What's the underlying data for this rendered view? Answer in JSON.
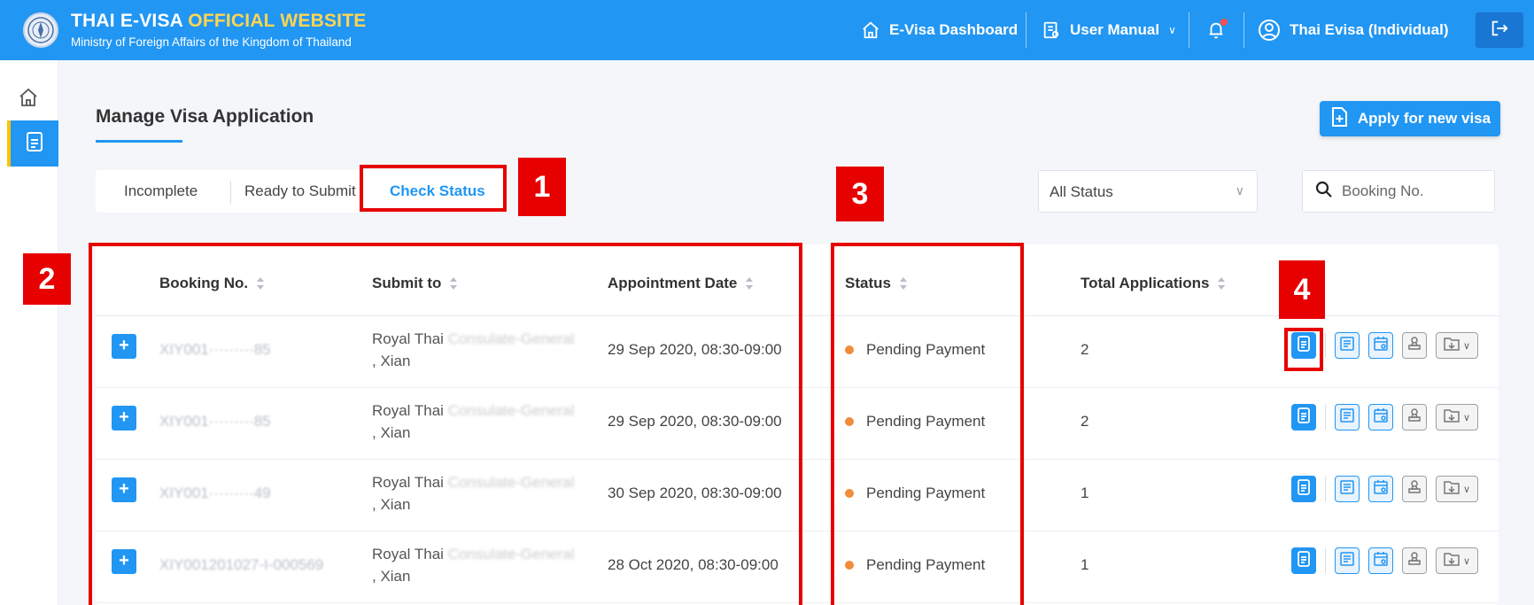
{
  "header": {
    "title_main": "THAI E-VISA ",
    "title_highlight": "OFFICIAL WEBSITE",
    "subtitle": "Ministry of Foreign Affairs of the Kingdom of Thailand",
    "nav": {
      "dashboard": "E-Visa Dashboard",
      "manual": "User Manual",
      "user": "Thai Evisa (Individual)"
    }
  },
  "page": {
    "title": "Manage Visa Application",
    "apply_button": "Apply for new visa"
  },
  "tabs": [
    "Incomplete",
    "Ready to Submit",
    "Check Status"
  ],
  "filters": {
    "status_selected": "All Status",
    "search_placeholder": "Booking No."
  },
  "table": {
    "columns": [
      "Booking No.",
      "Submit to",
      "Appointment Date",
      "Status",
      "Total Applications"
    ],
    "rows": [
      {
        "booking": "XIY001·········85",
        "submit_line1": "Royal Thai ",
        "submit_faded": "Consulate-General",
        "submit_line2": ", Xian",
        "appointment": "29 Sep 2020, 08:30-09:00",
        "status": "Pending Payment",
        "total": "2"
      },
      {
        "booking": "XIY001·········85",
        "submit_line1": "Royal Thai ",
        "submit_faded": "Consulate-General",
        "submit_line2": ", Xian",
        "appointment": "29 Sep 2020, 08:30-09:00",
        "status": "Pending Payment",
        "total": "2"
      },
      {
        "booking": "XIY001·········49",
        "submit_line1": "Royal Thai ",
        "submit_faded": "Consulate-General",
        "submit_line2": ", Xian",
        "appointment": "30 Sep 2020, 08:30-09:00",
        "status": "Pending Payment",
        "total": "1"
      },
      {
        "booking": "XIY001201027-I-000569",
        "submit_line1": "Royal Thai ",
        "submit_faded": "Consulate-General",
        "submit_line2": ", Xian",
        "appointment": "28 Oct 2020, 08:30-09:00",
        "status": "Pending Payment",
        "total": "1"
      }
    ]
  },
  "annotations": [
    "1",
    "2",
    "3",
    "4"
  ],
  "colors": {
    "primary": "#2196f3",
    "annotation": "#e60000",
    "pending_dot": "#f08c3a",
    "brand_highlight": "#ffd54f"
  }
}
